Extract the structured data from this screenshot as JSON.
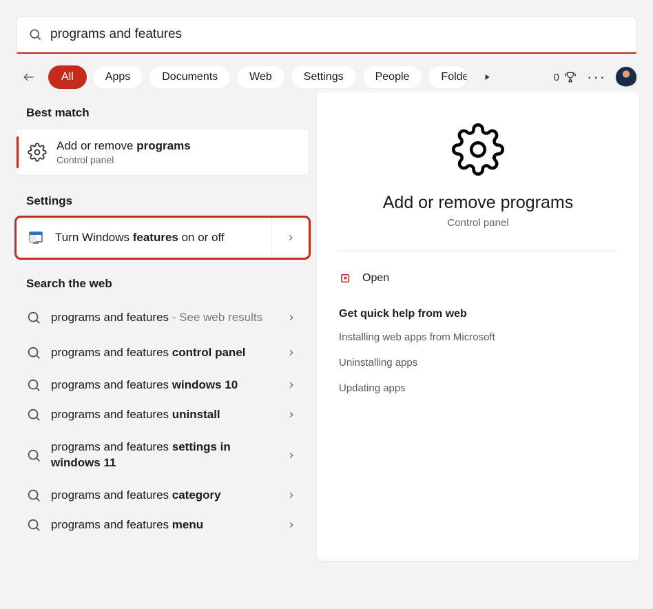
{
  "search": {
    "value": "programs and features"
  },
  "tabs": [
    "All",
    "Apps",
    "Documents",
    "Web",
    "Settings",
    "People",
    "Folders"
  ],
  "active_tab_index": 0,
  "points": {
    "count": "0"
  },
  "sections": {
    "best_match": "Best match",
    "settings": "Settings",
    "search_web": "Search the web"
  },
  "best": {
    "title_pre": "Add or remove ",
    "title_bold": "programs",
    "subtitle": "Control panel"
  },
  "settings_item": {
    "pre": "Turn Windows ",
    "bold": "features",
    "post": " on or off"
  },
  "web_results": [
    {
      "plain": "programs and features",
      "bold": "",
      "suffix": " - See web results",
      "tall": true
    },
    {
      "plain": "programs and features ",
      "bold": "control panel",
      "suffix": "",
      "tall": true
    },
    {
      "plain": "programs and features ",
      "bold": "windows 10",
      "suffix": ""
    },
    {
      "plain": "programs and features ",
      "bold": "uninstall",
      "suffix": ""
    },
    {
      "plain": "programs and features ",
      "bold": "settings in windows 11",
      "suffix": "",
      "tall": true
    },
    {
      "plain": "programs and features ",
      "bold": "category",
      "suffix": ""
    },
    {
      "plain": "programs and features ",
      "bold": "menu",
      "suffix": ""
    }
  ],
  "preview": {
    "title": "Add or remove programs",
    "subtitle": "Control panel",
    "open_label": "Open",
    "help_title": "Get quick help from web",
    "help_links": [
      "Installing web apps from Microsoft",
      "Uninstalling apps",
      "Updating apps"
    ]
  }
}
